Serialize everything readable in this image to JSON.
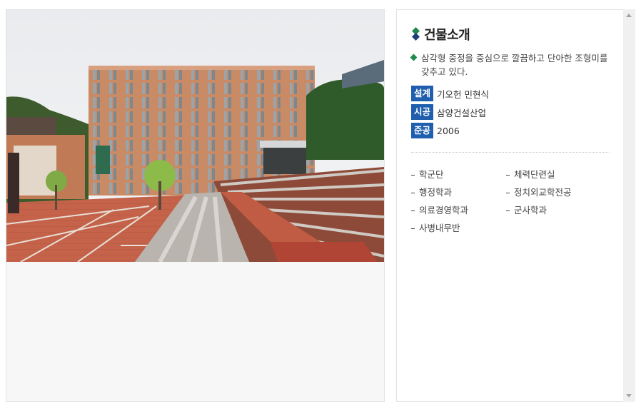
{
  "photo": {
    "alt": "building-photo"
  },
  "info": {
    "title": "건물소개",
    "description": "삼각형 중정을 중심으로 깔끔하고 단아한 조형미를 갖추고 있다.",
    "design_label": "설계",
    "design_value": "기오헌 민현식",
    "construction_label": "시공",
    "construction_value": "삼양건설산업",
    "completion_label": "준공",
    "completion_value": "2006"
  },
  "departments": [
    "학군단",
    "체력단련실",
    "행정학과",
    "정치외교학전공",
    "의료경영학과",
    "군사학과",
    "사병내무반"
  ],
  "colors": {
    "badge": "#1f5fae",
    "bullet": "#1f8a4c",
    "diamond_top": "#1f8a4c",
    "diamond_bottom": "#1f3f7a"
  }
}
